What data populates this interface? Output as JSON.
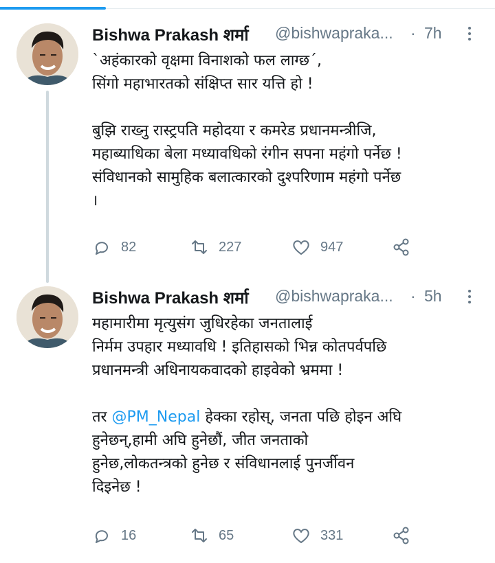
{
  "tweets": [
    {
      "author_name": "Bishwa Prakash शर्मा",
      "handle": "@bishwapraka...",
      "time_sep": "·",
      "time": "7h",
      "lines": [
        "`अहंकारको वृक्षमा विनाशको फल लाग्छ´,",
        "सिंगो महाभारतको संक्षिप्त सार यत्ति हो !",
        "",
        "बुझि राख्नु रास्ट्रपति महोदया र कमरेड प्रधानमन्त्रीजि,",
        "महाब्याधिका बेला मध्यावधिको रंगीन सपना महंगो पर्नेछ !",
        "संविधानको सामुहिक बलात्कारको दुश्परिणाम महंगो पर्नेछ",
        "।"
      ],
      "replies": "82",
      "retweets": "227",
      "likes": "947"
    },
    {
      "author_name": "Bishwa Prakash शर्मा",
      "handle": "@bishwapraka...",
      "time_sep": "·",
      "time": "5h",
      "lines": [
        "महामारीमा मृत्युसंग जुधिरहेका जनतालाई",
        "निर्मम उपहार मध्यावधि ! इतिहासको भिन्न कोतपर्वपछि",
        "प्रधानमन्त्री अधिनायकवादको हाइवेको भ्रममा !",
        ""
      ],
      "line5_before": "तर ",
      "mention": "@PM_Nepal",
      "line5_after": " हेक्का रहोस्, जनता पछि होइन अघि",
      "lines_after": [
        "हुनेछन्,हामी अघि हुनेछौं, जीत जनताको",
        "हुनेछ,लोकतन्त्रको हुनेछ र संविधानलाई पुनर्जीवन",
        "दिइनेछ !"
      ],
      "replies": "16",
      "retweets": "65",
      "likes": "331"
    }
  ],
  "icons": {
    "reply": "reply-icon",
    "retweet": "retweet-icon",
    "like": "heart-icon",
    "share": "share-icon",
    "more": "more-icon"
  },
  "colors": {
    "accent": "#1d9bf0",
    "muted": "#657786",
    "text": "#14171a",
    "thread_line": "#cfd9de"
  }
}
